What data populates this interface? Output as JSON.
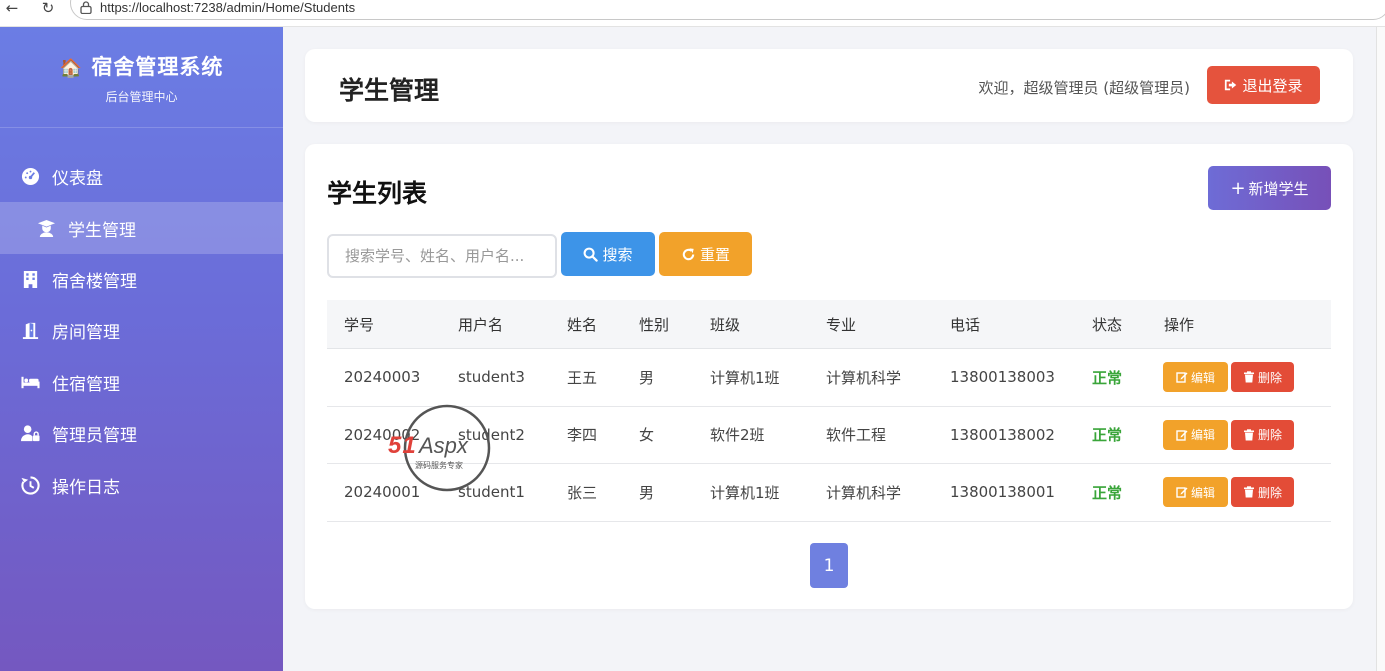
{
  "browser": {
    "url": "https://localhost:7238/admin/Home/Students"
  },
  "brand": {
    "title": "宿舍管理系统",
    "subtitle": "后台管理中心",
    "emoji": "🏠"
  },
  "sidebar": {
    "items": [
      {
        "label": "仪表盘",
        "icon": "dashboard-icon"
      },
      {
        "label": "学生管理",
        "icon": "student-icon",
        "active": true
      },
      {
        "label": "宿舍楼管理",
        "icon": "building-icon"
      },
      {
        "label": "房间管理",
        "icon": "door-icon"
      },
      {
        "label": "住宿管理",
        "icon": "bed-icon"
      },
      {
        "label": "管理员管理",
        "icon": "user-lock-icon"
      },
      {
        "label": "操作日志",
        "icon": "history-icon"
      }
    ]
  },
  "header": {
    "title": "学生管理",
    "welcome": "欢迎，超级管理员 (超级管理员)",
    "logout_label": "退出登录"
  },
  "main": {
    "list_title": "学生列表",
    "add_label": "新增学生",
    "search_placeholder": "搜索学号、姓名、用户名...",
    "search_label": "搜索",
    "reset_label": "重置",
    "columns": [
      "学号",
      "用户名",
      "姓名",
      "性别",
      "班级",
      "专业",
      "电话",
      "状态",
      "操作"
    ],
    "rows": [
      {
        "id": "20240003",
        "username": "student3",
        "name": "王五",
        "gender": "男",
        "class": "计算机1班",
        "major": "计算机科学",
        "phone": "13800138003",
        "status": "正常"
      },
      {
        "id": "20240002",
        "username": "student2",
        "name": "李四",
        "gender": "女",
        "class": "软件2班",
        "major": "软件工程",
        "phone": "13800138002",
        "status": "正常"
      },
      {
        "id": "20240001",
        "username": "student1",
        "name": "张三",
        "gender": "男",
        "class": "计算机1班",
        "major": "计算机科学",
        "phone": "13800138001",
        "status": "正常"
      }
    ],
    "edit_label": "编辑",
    "delete_label": "删除",
    "pagination": {
      "current": "1"
    }
  },
  "watermark": {
    "brand": "51Aspx",
    "tagline": "源码服务专家"
  },
  "colors": {
    "sidebar_top": "#6b7de4",
    "sidebar_bottom": "#7458c0",
    "danger": "#e5533d",
    "primary": "#3d94e8",
    "warning": "#f2a22a",
    "success": "#3aa53a"
  }
}
